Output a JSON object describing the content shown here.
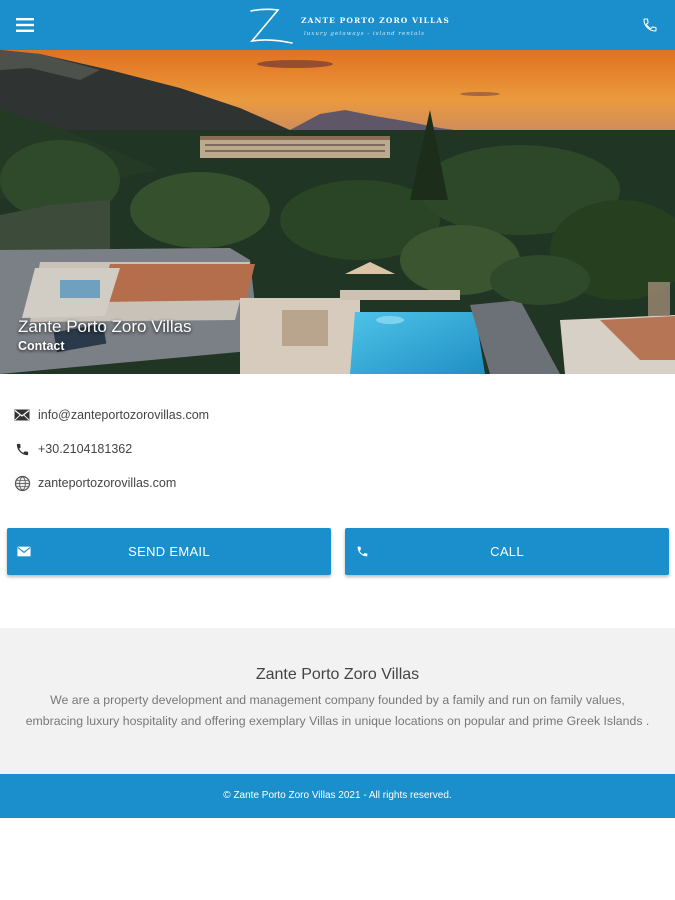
{
  "header": {
    "brand_name": "ZANTE PORTO ZORO VILLAS",
    "brand_tagline": "luxury getaways - island rentals",
    "brand_color": "#1a8fcb",
    "menu_icon": "hamburger-menu-icon",
    "phone_icon": "phone-icon"
  },
  "hero": {
    "title": "Zante Porto Zoro Villas",
    "subtitle": "Contact"
  },
  "contact": {
    "email": "info@zanteportozorovillas.com",
    "phone": "+30.2104181362",
    "website": "zanteportozorovillas.com",
    "email_icon": "envelope-icon",
    "phone_icon": "phone-icon",
    "website_icon": "globe-icon"
  },
  "actions": {
    "send_email_label": "SEND EMAIL",
    "call_label": "CALL"
  },
  "about": {
    "title": "Zante Porto Zoro Villas",
    "text": "We are a property development and management company founded by a family and run on family values, embracing luxury hospitality and offering exemplary Villas in unique locations on popular and prime Greek Islands ."
  },
  "footer": {
    "copyright": "© Zante Porto Zoro Villas 2021 - All rights reserved."
  }
}
